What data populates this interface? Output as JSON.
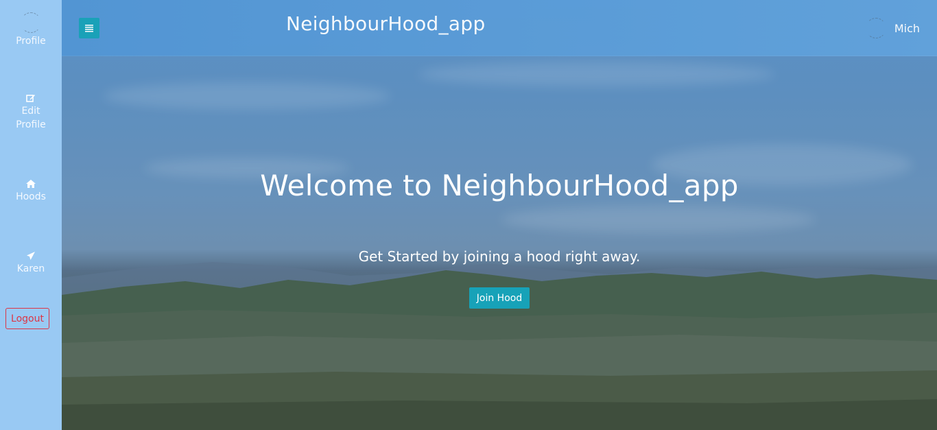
{
  "sidebar": {
    "profile": {
      "label": "Profile"
    },
    "edit_profile": {
      "label_line1": "Edit",
      "label_line2": "Profile",
      "icon": "edit-icon"
    },
    "hoods": {
      "label": "Hoods",
      "icon": "home-icon"
    },
    "karen": {
      "label": "Karen",
      "icon": "paper-plane-icon"
    },
    "logout": {
      "label": "Logout"
    }
  },
  "header": {
    "brand": "NeighbourHood_app",
    "menu_icon": "menu-icon",
    "user_name": "Mich"
  },
  "hero": {
    "title": "Welcome to NeighbourHood_app",
    "subtitle": "Get Started by joining a hood right away.",
    "cta_label": "Join Hood"
  },
  "colors": {
    "sidebar_bg": "#99c9f3",
    "topbar_bg": "#5a9ed8",
    "accent": "#17a2b8",
    "logout": "#dc3545"
  }
}
